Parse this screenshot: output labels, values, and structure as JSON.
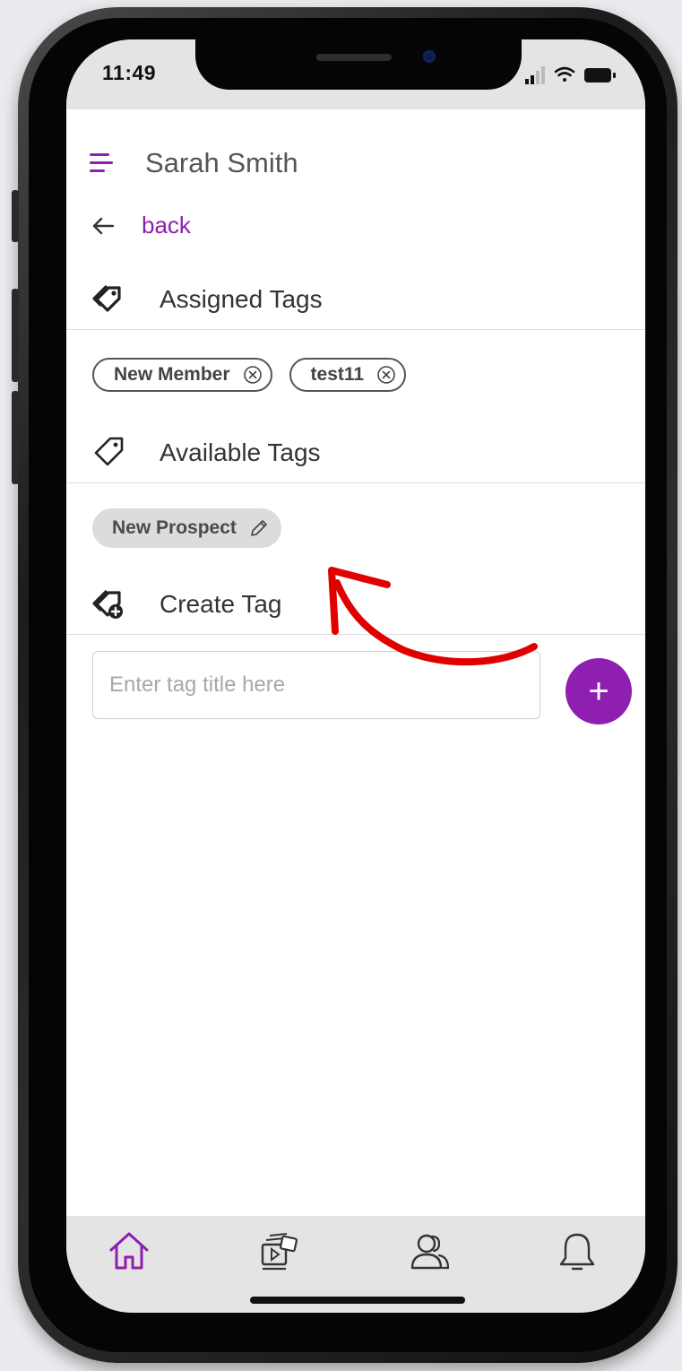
{
  "status_bar": {
    "time": "11:49",
    "icons": [
      "signal-icon",
      "wifi-icon",
      "battery-icon"
    ]
  },
  "header": {
    "user_name": "Sarah Smith",
    "menu_icon": "hamburger-menu-icon"
  },
  "back": {
    "label": "back",
    "icon": "arrow-left-icon"
  },
  "sections": {
    "assigned_title": "Assigned Tags",
    "available_title": "Available Tags",
    "create_title": "Create Tag"
  },
  "assigned_tags": [
    {
      "label": "New Member"
    },
    {
      "label": "test11"
    }
  ],
  "available_tags": [
    {
      "label": "New Prospect"
    }
  ],
  "create_tag": {
    "placeholder": "Enter tag title here",
    "value": "",
    "add_label": "+"
  },
  "bottom_nav": [
    "home-icon",
    "media-icon",
    "people-icon",
    "bell-icon"
  ],
  "colors": {
    "accent": "#8e1fb0",
    "annotation_arrow": "#e10000"
  }
}
